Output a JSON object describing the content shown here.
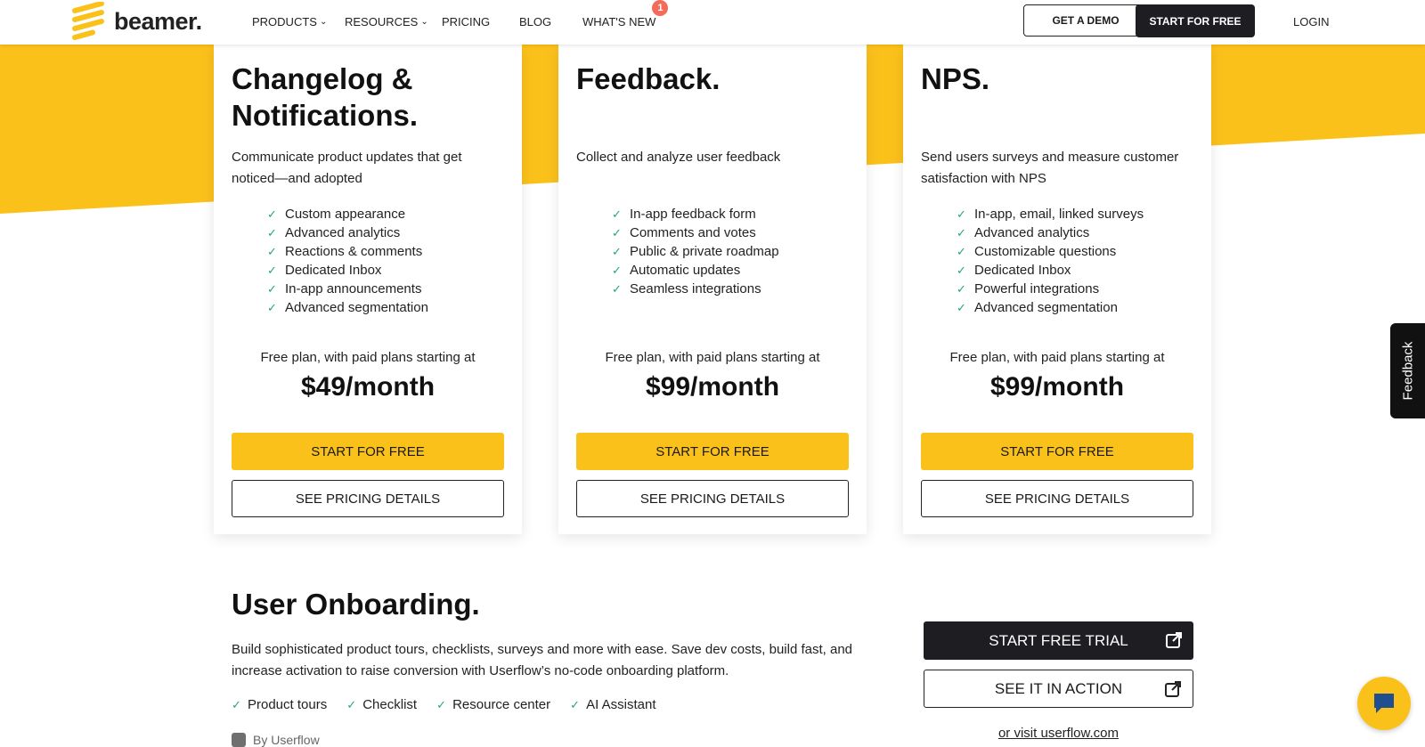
{
  "colors": {
    "accent": "#fbc11b",
    "dark": "#1e1e22",
    "check": "#25a57a",
    "badge": "#f26b5b"
  },
  "nav": {
    "logo_text": "beamer.",
    "items": [
      {
        "label": "PRODUCTS",
        "dropdown": true
      },
      {
        "label": "RESOURCES",
        "dropdown": true
      },
      {
        "label": "PRICING"
      },
      {
        "label": "BLOG"
      },
      {
        "label": "WHAT'S NEW",
        "badge": "1"
      }
    ],
    "demo_label": "GET A DEMO",
    "start_label": "START FOR FREE",
    "login_label": "LOGIN"
  },
  "cards": [
    {
      "title": "Changelog & Notifications.",
      "description": "Communicate product updates that get noticed—and adopted",
      "features": [
        "Custom appearance",
        "Advanced analytics",
        "Reactions & comments",
        "Dedicated Inbox",
        "In-app announcements",
        "Advanced segmentation"
      ],
      "plan_note": "Free plan, with paid plans starting at",
      "price": "$49/month",
      "primary_label": "START FOR FREE",
      "secondary_label": "SEE PRICING DETAILS"
    },
    {
      "title": "Feedback.",
      "description": "Collect and analyze user feedback",
      "features": [
        "In-app feedback form",
        "Comments and votes",
        "Public & private roadmap",
        "Automatic updates",
        "Seamless integrations"
      ],
      "plan_note": "Free plan, with paid plans starting at",
      "price": "$99/month",
      "primary_label": "START FOR FREE",
      "secondary_label": "SEE PRICING DETAILS"
    },
    {
      "title": "NPS.",
      "description": "Send users surveys and measure customer satisfaction with NPS",
      "features": [
        "In-app, email, linked surveys",
        "Advanced analytics",
        "Customizable questions",
        "Dedicated Inbox",
        "Powerful integrations",
        "Advanced segmentation"
      ],
      "plan_note": "Free plan, with paid plans starting at",
      "price": "$99/month",
      "primary_label": "START FOR FREE",
      "secondary_label": "SEE PRICING DETAILS"
    }
  ],
  "onboarding": {
    "title": "User Onboarding.",
    "description": "Build sophisticated product tours, checklists, surveys and more with ease. Save dev costs, build fast, and increase activation to raise conversion with Userflow’s no-code onboarding platform.",
    "features": [
      "Product tours",
      "Checklist",
      "Resource center",
      "AI Assistant"
    ],
    "by_label": "By Userflow",
    "trial_label": "START FREE TRIAL",
    "action_label": "SEE IT IN ACTION",
    "visit_label": "or visit userflow.com"
  },
  "feedback_tab_label": "Feedback"
}
